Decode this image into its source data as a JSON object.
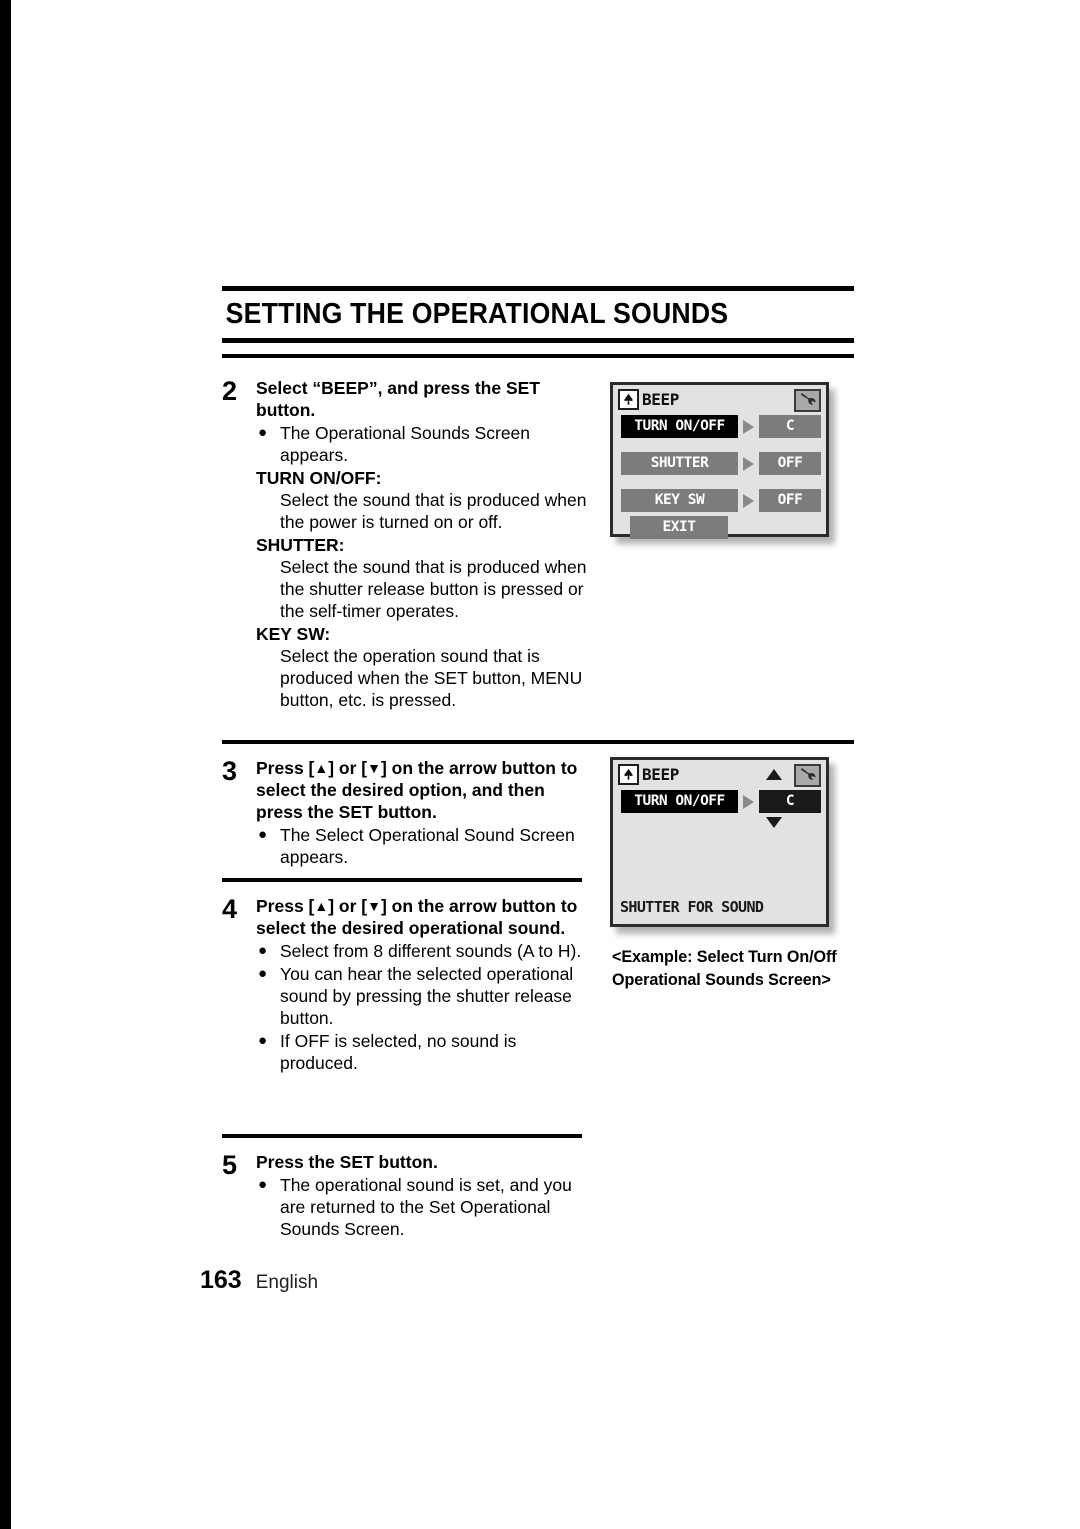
{
  "document": {
    "chapter_title": "SETTING THE OPERATIONAL SOUNDS",
    "page_number": "163",
    "language": "English"
  },
  "steps": [
    {
      "number": "2",
      "heading": "Select “BEEP”, and press the SET button.",
      "bullets": [
        "The Operational Sounds Screen appears."
      ],
      "definitions": [
        {
          "term": "TURN ON/OFF:",
          "description": "Select the sound that is produced when the power is turned on or off."
        },
        {
          "term": "SHUTTER:",
          "description": "Select the sound that is produced when the shutter release button is pressed or the self-timer operates."
        },
        {
          "term": "KEY SW:",
          "description": "Select the operation sound that is produced when the SET button, MENU button, etc. is pressed."
        }
      ]
    },
    {
      "number": "3",
      "heading_parts": {
        "prefix": "Press [",
        "up": "▲",
        "mid": "] or [",
        "down": "▼",
        "suffix": "] on the arrow button to select the desired option, and then press the SET button."
      },
      "bullets": [
        "The Select Operational Sound Screen appears."
      ]
    },
    {
      "number": "4",
      "heading_parts": {
        "prefix": "Press [",
        "up": "▲",
        "mid": "] or [",
        "down": "▼",
        "suffix": "] on the arrow button to select the desired operational sound."
      },
      "bullets": [
        "Select from 8 different sounds (A to H).",
        "You can hear the selected operational sound by pressing the shutter release button.",
        "If OFF is selected, no sound is produced."
      ]
    },
    {
      "number": "5",
      "heading": "Press the SET button.",
      "bullets": [
        "The operational sound is set, and you are returned to the Set Operational Sounds Screen."
      ]
    }
  ],
  "screens": {
    "operational_sounds": {
      "title": "BEEP",
      "mode_icon": "up-arrow-mode-icon",
      "settings_icon": "wrench-icon",
      "rows": [
        {
          "label": "TURN ON/OFF",
          "value": "C",
          "selected": true
        },
        {
          "label": "SHUTTER",
          "value": "OFF",
          "selected": false
        },
        {
          "label": "KEY SW",
          "value": "OFF",
          "selected": false
        }
      ],
      "exit_label": "EXIT"
    },
    "select_sound": {
      "title": "BEEP",
      "mode_icon": "up-arrow-mode-icon",
      "settings_icon": "wrench-icon",
      "row": {
        "label": "TURN ON/OFF",
        "value": "C"
      },
      "scroll_up_icon": "triangle-up-icon",
      "scroll_down_icon": "triangle-down-icon",
      "footer_text": "SHUTTER FOR SOUND",
      "caption_line1": "<Example: Select Turn On/Off",
      "caption_line2": "Operational Sounds Screen>"
    }
  },
  "colors": {
    "chip_grey": "#7c7c7c",
    "chip_selected": "#000000",
    "lcd_background": "#e2e2e2",
    "lcd_border": "#2b2b2b"
  }
}
